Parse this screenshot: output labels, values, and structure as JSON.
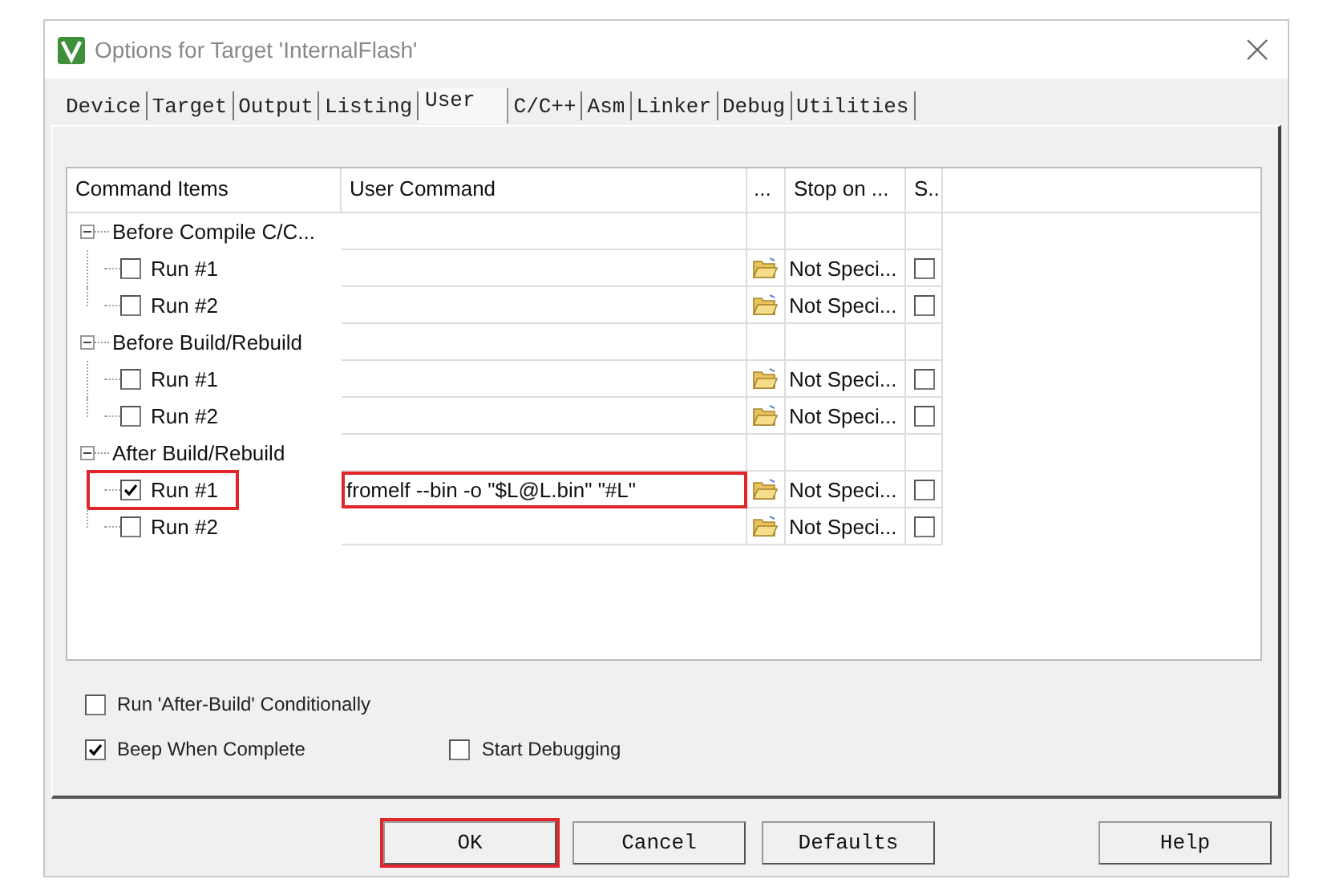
{
  "window": {
    "title": "Options for Target 'InternalFlash'"
  },
  "tabs": [
    {
      "label": "Device",
      "selected": false
    },
    {
      "label": "Target",
      "selected": false
    },
    {
      "label": "Output",
      "selected": false
    },
    {
      "label": "Listing",
      "selected": false
    },
    {
      "label": "User",
      "selected": true
    },
    {
      "label": "C/C++",
      "selected": false
    },
    {
      "label": "Asm",
      "selected": false
    },
    {
      "label": "Linker",
      "selected": false
    },
    {
      "label": "Debug",
      "selected": false
    },
    {
      "label": "Utilities",
      "selected": false
    }
  ],
  "table": {
    "columns": [
      "Command Items",
      "User Command",
      "...",
      "Stop on ...",
      "S.."
    ],
    "groups": [
      {
        "label": "Before Compile C/C...",
        "expanded": true,
        "items": [
          {
            "label": "Run #1",
            "checked": false,
            "highlighted": false,
            "command_highlighted": false,
            "stop_on": "Not Speci...",
            "s_checked": false
          },
          {
            "label": "Run #2",
            "checked": false,
            "highlighted": false,
            "command_highlighted": false,
            "stop_on": "Not Speci...",
            "s_checked": false
          }
        ]
      },
      {
        "label": "Before Build/Rebuild",
        "expanded": true,
        "items": [
          {
            "label": "Run #1",
            "checked": false,
            "highlighted": false,
            "command_highlighted": false,
            "stop_on": "Not Speci...",
            "s_checked": false
          },
          {
            "label": "Run #2",
            "checked": false,
            "highlighted": false,
            "command_highlighted": false,
            "stop_on": "Not Speci...",
            "s_checked": false
          }
        ]
      },
      {
        "label": "After Build/Rebuild",
        "expanded": true,
        "items": [
          {
            "label": "Run #1",
            "checked": true,
            "highlighted": true,
            "command": "fromelf --bin -o \"$L@L.bin\" \"#L\"",
            "command_highlighted": true,
            "stop_on": "Not Speci...",
            "s_checked": false
          },
          {
            "label": "Run #2",
            "checked": false,
            "highlighted": false,
            "command_highlighted": false,
            "stop_on": "Not Speci...",
            "s_checked": false
          }
        ]
      }
    ]
  },
  "options": [
    [
      {
        "label": "Run 'After-Build' Conditionally",
        "checked": false
      }
    ],
    [
      {
        "label": "Beep When Complete",
        "checked": true
      },
      {
        "label": "Start Debugging",
        "checked": false
      }
    ]
  ],
  "buttons": [
    {
      "label": "OK",
      "highlighted": true
    },
    {
      "label": "Cancel",
      "highlighted": false
    },
    {
      "label": "Defaults",
      "highlighted": false
    },
    {
      "label": "Help",
      "highlighted": false
    }
  ]
}
